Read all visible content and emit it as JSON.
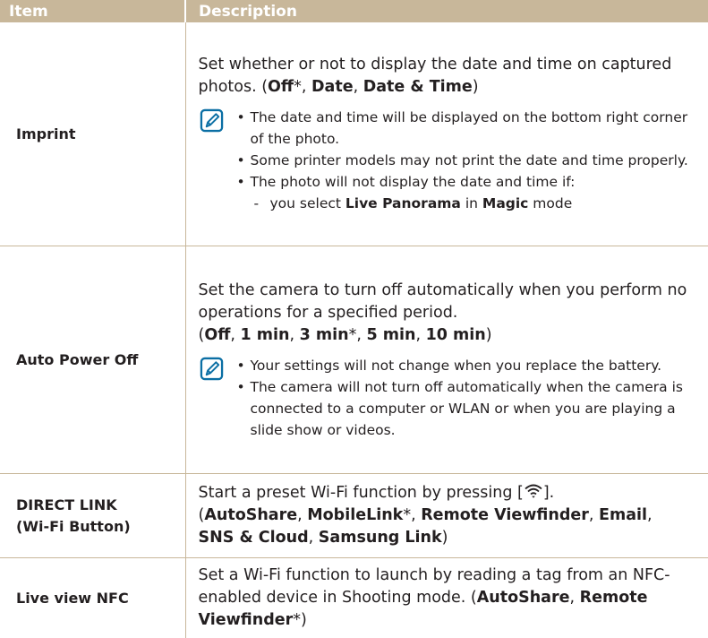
{
  "table": {
    "headers": {
      "item": "Item",
      "description": "Description"
    },
    "imprint": {
      "item": "Imprint",
      "desc": "Set whether or not to display the date and time on captured photos. (",
      "off": "Off",
      "star": "*",
      "sep": ", ",
      "date": "Date",
      "date_time": "Date & Time",
      "close": ")",
      "note1": "The date and time will be displayed on the bottom right corner of the photo.",
      "note2": "Some printer models may not print the date and time properly.",
      "note3": "The photo will not display the date and time if:",
      "sub_pre": "you select ",
      "sub_b1": "Live Panorama",
      "sub_mid": " in ",
      "sub_b2": "Magic",
      "sub_post": " mode"
    },
    "auto_power_off": {
      "item": "Auto Power Off",
      "desc": "Set the camera to turn off automatically when you perform no operations for a specified period.",
      "open": "(",
      "o1": "Off",
      "o2": "1 min",
      "o3": "3 min",
      "star": "*",
      "o4": "5 min",
      "o5": "10 min",
      "sep": ", ",
      "close": ")",
      "note1": "Your settings will not change when you replace the battery.",
      "note2": "The camera will not turn off automatically when the camera is connected to a computer or WLAN or when you are playing a slide show or videos."
    },
    "direct_link": {
      "item_line1": "DIRECT LINK",
      "item_line2": "(Wi-Fi Button)",
      "desc": "Start a preset Wi-Fi function by pressing [",
      "desc_close": "].",
      "open": "(",
      "o1": "AutoShare",
      "o2": "MobileLink",
      "star": "*",
      "o3": "Remote Viewfinder",
      "o4": "Email",
      "o5": "SNS & Cloud",
      "o6": "Samsung Link",
      "sep": ", ",
      "close": ")"
    },
    "live_view_nfc": {
      "item": "Live view NFC",
      "desc": "Set a Wi-Fi function to launch by reading a tag from an NFC-enabled device in Shooting mode. (",
      "o1": "AutoShare",
      "sep": ", ",
      "o2": "Remote Viewfinder",
      "star": "*",
      "close": ")"
    }
  },
  "icons": {
    "note": "note-pencil-icon",
    "wifi": "wifi-icon"
  },
  "colors": {
    "header_bg": "#c8b79a",
    "note_icon": "#0b6fa4",
    "text": "#231f20"
  }
}
